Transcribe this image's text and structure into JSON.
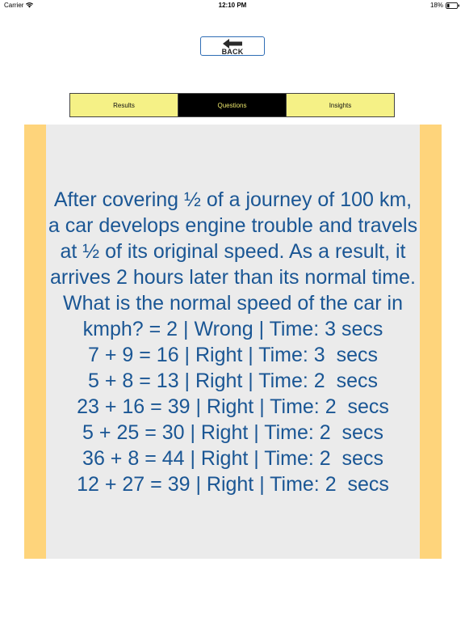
{
  "status_bar": {
    "carrier": "Carrier",
    "time": "12:10 PM",
    "battery": "18%"
  },
  "back_button": {
    "label": "BACK",
    "icon": "arrow-left-icon"
  },
  "tabs": [
    {
      "label": "Results",
      "active": false
    },
    {
      "label": "Questions",
      "active": true
    },
    {
      "label": "Insights",
      "active": false
    }
  ],
  "questions": [
    "After covering ½ of a journey of 100 km, a car develops engine trouble and travels at ½ of its original speed. As a result, it arrives 2 hours later than its normal time. What is the normal speed of the car in kmph? = 2 | Wrong | Time: 3 secs",
    "7 + 9 = 16 | Right | Time: 3  secs",
    "5 + 8 = 13 | Right | Time: 2  secs",
    "23 + 16 = 39 | Right | Time: 2  secs",
    "5 + 25 = 30 | Right | Time: 2  secs",
    "36 + 8 = 44 | Right | Time: 2  secs",
    "12 + 27 = 39 | Right | Time: 2  secs"
  ],
  "colors": {
    "tab_inactive_bg": "#f5f186",
    "tab_active_bg": "#000000",
    "tab_active_text": "#e9e36a",
    "panel_border": "#fed47b",
    "panel_bg": "#ebebeb",
    "question_text": "#1a5694",
    "back_button_border": "#2f6db5"
  }
}
